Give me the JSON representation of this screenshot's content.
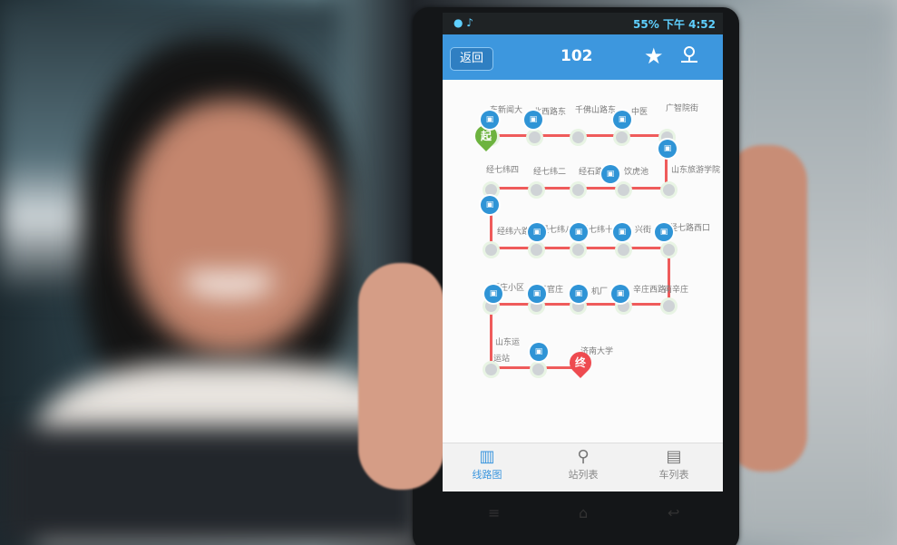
{
  "status_bar": {
    "left_icons": "● ♪",
    "time": "4:52",
    "battery": "55%",
    "am_pm": "下午"
  },
  "header": {
    "back_label": "返回",
    "route_number": "102"
  },
  "stations_row1": [
    "东新闻大",
    "北西路东",
    "千佛山路东",
    "中医",
    "广智院街"
  ],
  "stations_row2": [
    "经七纬四",
    "经七纬二",
    "经石路",
    "饮虎池",
    "山东旅游学院"
  ],
  "stations_row3": [
    "经纬六路",
    "经七纬八",
    "经七纬十二",
    "兴街",
    "经七路西口"
  ],
  "stations_row4": [
    "医庄小区",
    "王官庄",
    "机厂",
    "辛庄西路",
    "南辛庄"
  ],
  "stations_row5": [
    "山东运",
    "运站",
    "济南大学"
  ],
  "markers": {
    "start": "起",
    "end": "终"
  },
  "tabs": [
    {
      "label": "线路图",
      "icon": "map-icon"
    },
    {
      "label": "站列表",
      "icon": "location-pin-icon"
    },
    {
      "label": "车列表",
      "icon": "bus-icon"
    }
  ]
}
